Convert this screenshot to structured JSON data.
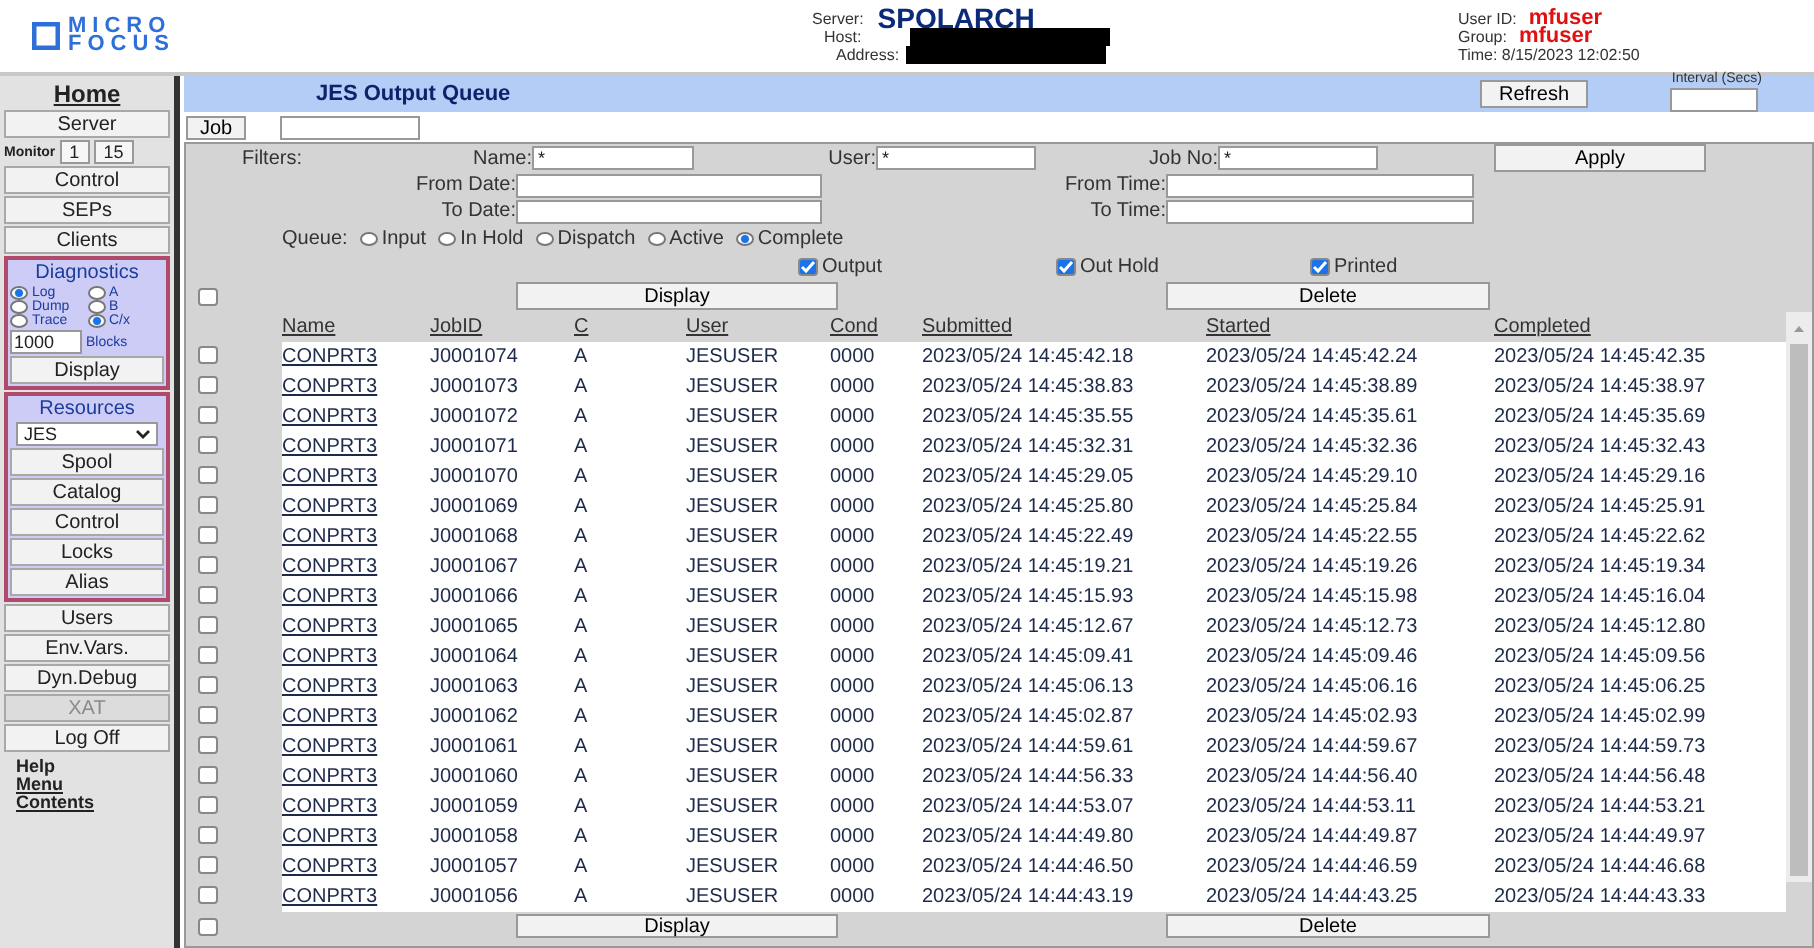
{
  "header": {
    "logo_top": "MICRO",
    "logo_bottom": "FOCUS",
    "server_label": "Server:",
    "server": "SPOLARCH",
    "host_label": "Host:",
    "address_label": "Address:",
    "user_id_label": "User ID:",
    "user_id": "mfuser",
    "group_label": "Group:",
    "group": "mfuser",
    "time": "Time: 8/15/2023 12:02:50"
  },
  "sidebar": {
    "home": "Home",
    "server": "Server",
    "monitor_label": "Monitor",
    "monitor_values": [
      "1",
      "15"
    ],
    "top_buttons": [
      "Control",
      "SEPs",
      "Clients"
    ],
    "diagnostics": {
      "title": "Diagnostics",
      "options": [
        {
          "label": "Log",
          "selected": true
        },
        {
          "label": "A",
          "selected": false
        },
        {
          "label": "Dump",
          "selected": false
        },
        {
          "label": "B",
          "selected": false
        },
        {
          "label": "Trace",
          "selected": false
        },
        {
          "label": "C/x",
          "selected": true
        }
      ],
      "blocks_value": "1000",
      "blocks_label": "Blocks",
      "display": "Display"
    },
    "resources": {
      "title": "Resources",
      "select": "JES",
      "buttons": [
        "Spool",
        "Catalog",
        "Control",
        "Locks",
        "Alias"
      ]
    },
    "bottom_buttons": [
      {
        "label": "Users",
        "disabled": false
      },
      {
        "label": "Env.Vars.",
        "disabled": false
      },
      {
        "label": "Dyn.Debug",
        "disabled": false
      },
      {
        "label": "XAT",
        "disabled": true
      },
      {
        "label": "Log Off",
        "disabled": false
      }
    ],
    "help": {
      "title": "Help",
      "links": [
        "Menu",
        "Contents"
      ]
    }
  },
  "main": {
    "title": "JES Output Queue",
    "refresh": "Refresh",
    "interval_label": "Interval (Secs)",
    "job_button": "Job",
    "filters": {
      "label": "Filters:",
      "name": {
        "label": "Name:",
        "value": "*"
      },
      "user": {
        "label": "User:",
        "value": "*"
      },
      "job_no": {
        "label": "Job No:",
        "value": "*"
      },
      "apply": "Apply",
      "from_date": {
        "label": "From Date:"
      },
      "from_time": {
        "label": "From Time:"
      },
      "to_date": {
        "label": "To Date:"
      },
      "to_time": {
        "label": "To Time:"
      },
      "queue_label": "Queue:",
      "queue": [
        {
          "label": "Input",
          "selected": false
        },
        {
          "label": "In Hold",
          "selected": false
        },
        {
          "label": "Dispatch",
          "selected": false
        },
        {
          "label": "Active",
          "selected": false
        },
        {
          "label": "Complete",
          "selected": true
        }
      ],
      "types": [
        {
          "label": "Output",
          "checked": true
        },
        {
          "label": "Out Hold",
          "checked": true
        },
        {
          "label": "Printed",
          "checked": true
        }
      ]
    },
    "select_all": {
      "checked": false
    },
    "display": "Display",
    "delete": "Delete",
    "table": {
      "columns": [
        "Name",
        "JobID",
        "C",
        "User",
        "Cond",
        "Submitted",
        "Started",
        "Completed"
      ],
      "rows": [
        {
          "checked": false,
          "cells": [
            "CONPRT3",
            "J0001074",
            "A",
            "JESUSER",
            "0000",
            "2023/05/24 14:45:42.18",
            "2023/05/24 14:45:42.24",
            "2023/05/24 14:45:42.35"
          ]
        },
        {
          "checked": false,
          "cells": [
            "CONPRT3",
            "J0001073",
            "A",
            "JESUSER",
            "0000",
            "2023/05/24 14:45:38.83",
            "2023/05/24 14:45:38.89",
            "2023/05/24 14:45:38.97"
          ]
        },
        {
          "checked": false,
          "cells": [
            "CONPRT3",
            "J0001072",
            "A",
            "JESUSER",
            "0000",
            "2023/05/24 14:45:35.55",
            "2023/05/24 14:45:35.61",
            "2023/05/24 14:45:35.69"
          ]
        },
        {
          "checked": false,
          "cells": [
            "CONPRT3",
            "J0001071",
            "A",
            "JESUSER",
            "0000",
            "2023/05/24 14:45:32.31",
            "2023/05/24 14:45:32.36",
            "2023/05/24 14:45:32.43"
          ]
        },
        {
          "checked": false,
          "cells": [
            "CONPRT3",
            "J0001070",
            "A",
            "JESUSER",
            "0000",
            "2023/05/24 14:45:29.05",
            "2023/05/24 14:45:29.10",
            "2023/05/24 14:45:29.16"
          ]
        },
        {
          "checked": false,
          "cells": [
            "CONPRT3",
            "J0001069",
            "A",
            "JESUSER",
            "0000",
            "2023/05/24 14:45:25.80",
            "2023/05/24 14:45:25.84",
            "2023/05/24 14:45:25.91"
          ]
        },
        {
          "checked": false,
          "cells": [
            "CONPRT3",
            "J0001068",
            "A",
            "JESUSER",
            "0000",
            "2023/05/24 14:45:22.49",
            "2023/05/24 14:45:22.55",
            "2023/05/24 14:45:22.62"
          ]
        },
        {
          "checked": false,
          "cells": [
            "CONPRT3",
            "J0001067",
            "A",
            "JESUSER",
            "0000",
            "2023/05/24 14:45:19.21",
            "2023/05/24 14:45:19.26",
            "2023/05/24 14:45:19.34"
          ]
        },
        {
          "checked": false,
          "cells": [
            "CONPRT3",
            "J0001066",
            "A",
            "JESUSER",
            "0000",
            "2023/05/24 14:45:15.93",
            "2023/05/24 14:45:15.98",
            "2023/05/24 14:45:16.04"
          ]
        },
        {
          "checked": false,
          "cells": [
            "CONPRT3",
            "J0001065",
            "A",
            "JESUSER",
            "0000",
            "2023/05/24 14:45:12.67",
            "2023/05/24 14:45:12.73",
            "2023/05/24 14:45:12.80"
          ]
        },
        {
          "checked": false,
          "cells": [
            "CONPRT3",
            "J0001064",
            "A",
            "JESUSER",
            "0000",
            "2023/05/24 14:45:09.41",
            "2023/05/24 14:45:09.46",
            "2023/05/24 14:45:09.56"
          ]
        },
        {
          "checked": false,
          "cells": [
            "CONPRT3",
            "J0001063",
            "A",
            "JESUSER",
            "0000",
            "2023/05/24 14:45:06.13",
            "2023/05/24 14:45:06.16",
            "2023/05/24 14:45:06.25"
          ]
        },
        {
          "checked": false,
          "cells": [
            "CONPRT3",
            "J0001062",
            "A",
            "JESUSER",
            "0000",
            "2023/05/24 14:45:02.87",
            "2023/05/24 14:45:02.93",
            "2023/05/24 14:45:02.99"
          ]
        },
        {
          "checked": false,
          "cells": [
            "CONPRT3",
            "J0001061",
            "A",
            "JESUSER",
            "0000",
            "2023/05/24 14:44:59.61",
            "2023/05/24 14:44:59.67",
            "2023/05/24 14:44:59.73"
          ]
        },
        {
          "checked": false,
          "cells": [
            "CONPRT3",
            "J0001060",
            "A",
            "JESUSER",
            "0000",
            "2023/05/24 14:44:56.33",
            "2023/05/24 14:44:56.40",
            "2023/05/24 14:44:56.48"
          ]
        },
        {
          "checked": false,
          "cells": [
            "CONPRT3",
            "J0001059",
            "A",
            "JESUSER",
            "0000",
            "2023/05/24 14:44:53.07",
            "2023/05/24 14:44:53.11",
            "2023/05/24 14:44:53.21"
          ]
        },
        {
          "checked": false,
          "cells": [
            "CONPRT3",
            "J0001058",
            "A",
            "JESUSER",
            "0000",
            "2023/05/24 14:44:49.80",
            "2023/05/24 14:44:49.87",
            "2023/05/24 14:44:49.97"
          ]
        },
        {
          "checked": false,
          "cells": [
            "CONPRT3",
            "J0001057",
            "A",
            "JESUSER",
            "0000",
            "2023/05/24 14:44:46.50",
            "2023/05/24 14:44:46.59",
            "2023/05/24 14:44:46.68"
          ]
        },
        {
          "checked": false,
          "cells": [
            "CONPRT3",
            "J0001056",
            "A",
            "JESUSER",
            "0000",
            "2023/05/24 14:44:43.19",
            "2023/05/24 14:44:43.25",
            "2023/05/24 14:44:43.33"
          ]
        }
      ]
    },
    "bottom_select_all": {
      "checked": false
    },
    "bottom_display": "Display",
    "bottom_delete": "Delete"
  }
}
